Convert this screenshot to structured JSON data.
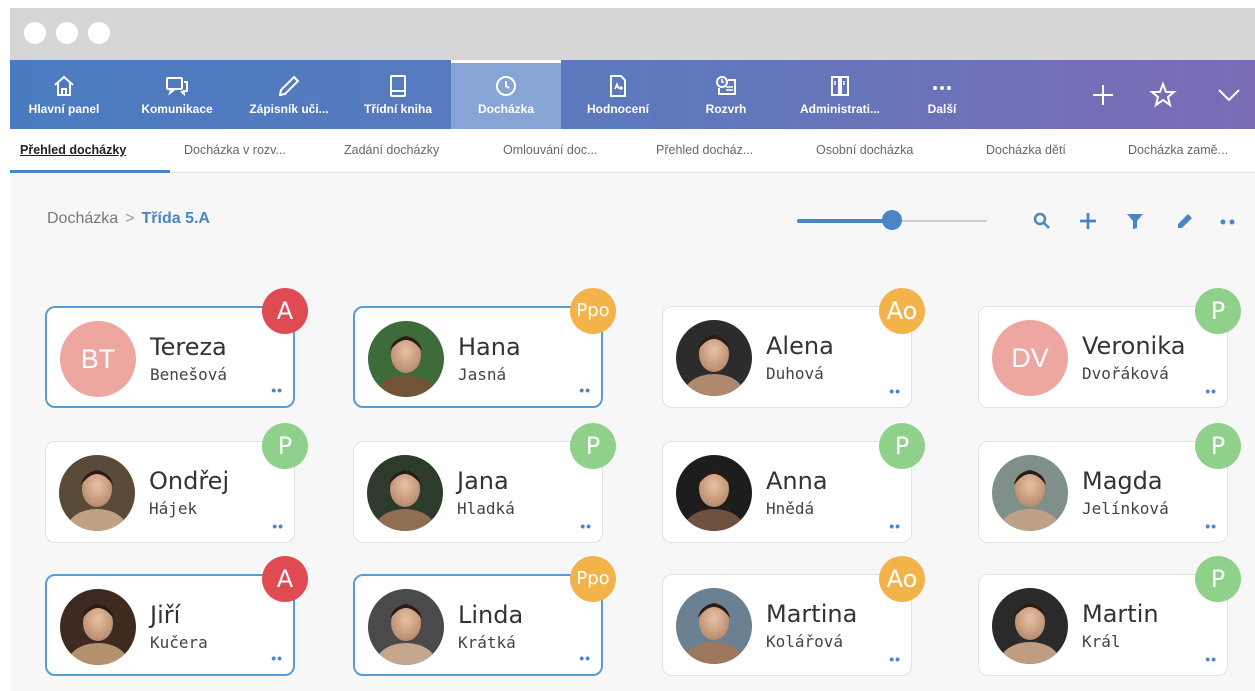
{
  "nav": {
    "items": [
      {
        "label": "Hlavní panel",
        "icon": "home-icon"
      },
      {
        "label": "Komunikace",
        "icon": "chat-icon"
      },
      {
        "label": "Zápisník uči...",
        "icon": "pen-icon"
      },
      {
        "label": "Třídní kniha",
        "icon": "book-icon"
      },
      {
        "label": "Docházka",
        "icon": "clock-icon"
      },
      {
        "label": "Hodnocení",
        "icon": "grade-icon"
      },
      {
        "label": "Rozvrh",
        "icon": "schedule-icon"
      },
      {
        "label": "Administrati...",
        "icon": "admin-icon"
      },
      {
        "label": "Další",
        "icon": "more-icon"
      }
    ],
    "active_index": 4,
    "right_icons": [
      "plus-icon",
      "star-icon",
      "chevron-down-icon"
    ]
  },
  "subtabs": [
    {
      "label": "Přehled docházky"
    },
    {
      "label": "Docházka v rozv..."
    },
    {
      "label": "Zadání docházky"
    },
    {
      "label": "Omlouvání doc..."
    },
    {
      "label": "Přehled docház..."
    },
    {
      "label": "Osobní docházka"
    },
    {
      "label": "Docházka dětí"
    },
    {
      "label": "Docházka zamě..."
    }
  ],
  "breadcrumb": {
    "root": "Docházka",
    "separator": ">",
    "current": "Třída 5.A"
  },
  "slider": {
    "level": 0.5
  },
  "toolbar_icons": [
    "search-icon",
    "plus-icon",
    "filter-icon",
    "edit-icon",
    "more-icon"
  ],
  "colors": {
    "accent": "#4a86c5",
    "badge_A": "#e04a53",
    "badge_P": "#8fd18a",
    "badge_Ppo": "#f2b44a",
    "badge_Ao": "#f2b44a",
    "initials_bg": "#eea6a1"
  },
  "students": [
    {
      "first": "Tereza",
      "last": "Benešová",
      "initials": "BT",
      "badge": "A",
      "selected": true
    },
    {
      "first": "Hana",
      "last": "Jasná",
      "badge": "Ppo",
      "selected": true
    },
    {
      "first": "Alena",
      "last": "Duhová",
      "badge": "Ao",
      "selected": false
    },
    {
      "first": "Veronika",
      "last": "Dvořáková",
      "initials": "DV",
      "badge": "P",
      "selected": false
    },
    {
      "first": "Ondřej",
      "last": "Hájek",
      "badge": "P",
      "selected": false
    },
    {
      "first": "Jana",
      "last": "Hladká",
      "badge": "P",
      "selected": false
    },
    {
      "first": "Anna",
      "last": "Hnědá",
      "badge": "P",
      "selected": false
    },
    {
      "first": "Magda",
      "last": "Jelínková",
      "badge": "P",
      "selected": false
    },
    {
      "first": "Jiří",
      "last": "Kučera",
      "badge": "A",
      "selected": true
    },
    {
      "first": "Linda",
      "last": "Krátká",
      "badge": "Ppo",
      "selected": true
    },
    {
      "first": "Martina",
      "last": "Kolářová",
      "badge": "Ao",
      "selected": false
    },
    {
      "first": "Martin",
      "last": "Král",
      "badge": "P",
      "selected": false
    }
  ],
  "card_more_label": "••"
}
